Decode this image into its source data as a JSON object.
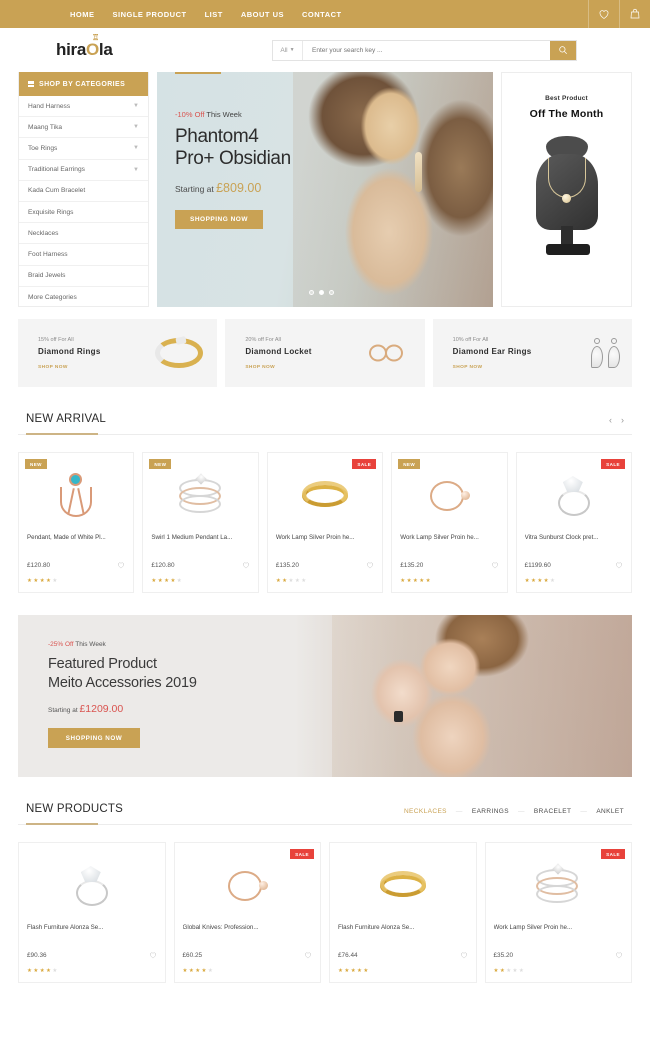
{
  "topbar": {
    "nav": [
      {
        "label": "HOME"
      },
      {
        "label": "SINGLE PRODUCT"
      },
      {
        "label": "LIST"
      },
      {
        "label": "ABOUT US"
      },
      {
        "label": "CONTACT"
      }
    ],
    "icons": [
      {
        "name": "wishlist-heart-icon"
      },
      {
        "name": "shopping-bag-icon"
      }
    ]
  },
  "header": {
    "logo_part1": "hira",
    "logo_o": "O",
    "logo_part2": "la",
    "search": {
      "category": "All",
      "placeholder": "Enter your search key ...",
      "value": ""
    }
  },
  "sidebar": {
    "title": "SHOP BY CATEGORIES",
    "items": [
      {
        "label": "Hand Harness",
        "expandable": true
      },
      {
        "label": "Maang Tika",
        "expandable": true
      },
      {
        "label": "Toe Rings",
        "expandable": true
      },
      {
        "label": "Traditional Earrings",
        "expandable": true
      },
      {
        "label": "Kada Cum Bracelet",
        "expandable": false
      },
      {
        "label": "Exquisite Rings",
        "expandable": false
      },
      {
        "label": "Necklaces",
        "expandable": false
      },
      {
        "label": "Foot Harness",
        "expandable": false
      },
      {
        "label": "Braid Jewels",
        "expandable": false
      },
      {
        "label": "More Categories",
        "expandable": false
      }
    ]
  },
  "hero": {
    "discount": "-10% Off",
    "kicker_rest": " This Week",
    "title_line1": "Phantom4",
    "title_line2": "Pro+ Obsidian",
    "starting_label": "Starting at ",
    "price": "£809.00",
    "button": "SHOPPING NOW"
  },
  "best_product": {
    "subtitle": "Best Product",
    "title": "Off The Month"
  },
  "promos": [
    {
      "off": "15% off For All",
      "name": "Diamond Rings",
      "shop": "SHOP NOW",
      "art": "ring-gold"
    },
    {
      "off": "20% off For All",
      "name": "Diamond Locket",
      "shop": "SHOP NOW",
      "art": "infinity"
    },
    {
      "off": "10% off For All",
      "name": "Diamond Ear Rings",
      "shop": "SHOP NOW",
      "art": "earrings"
    }
  ],
  "new_arrival": {
    "title": "NEW ARRIVAL",
    "prev": "‹",
    "next": "›",
    "products": [
      {
        "badge": "NEW",
        "badge_type": "new",
        "name": "Pendant, Made of White Pl...",
        "price": "£120.80",
        "rating": 4,
        "art": "pendant"
      },
      {
        "badge": "NEW",
        "badge_type": "new",
        "name": "Swirl 1 Medium Pendant La...",
        "price": "£120.80",
        "rating": 4,
        "art": "swirl"
      },
      {
        "badge": "SALE",
        "badge_type": "sale",
        "name": "Work Lamp Silver Proin he...",
        "price": "£135.20",
        "rating": 2,
        "art": "goldknot"
      },
      {
        "badge": "NEW",
        "badge_type": "new",
        "name": "Work Lamp Silver Proin he...",
        "price": "£135.20",
        "rating": 5,
        "art": "rose"
      },
      {
        "badge": "SALE",
        "badge_type": "sale",
        "name": "Vitra Sunburst Clock pret...",
        "price": "£1199.60",
        "rating": 4,
        "art": "solitaire"
      }
    ]
  },
  "featured": {
    "discount": "-25% Off",
    "kicker_rest": " This Week",
    "title_line1": "Featured Product",
    "title_line2": "Meito Accessories 2019",
    "starting_label": "Starting at ",
    "price": "£1209.00",
    "button": "SHOPPING NOW"
  },
  "new_products": {
    "title": "NEW PRODUCTS",
    "tabs": [
      {
        "label": "NECKLACES",
        "active": true
      },
      {
        "label": "EARRINGS",
        "active": false
      },
      {
        "label": "BRACELET",
        "active": false
      },
      {
        "label": "ANKLET",
        "active": false
      }
    ],
    "products": [
      {
        "badge": "",
        "badge_type": "",
        "name": "Flash Furniture Alonza Se...",
        "price": "£90.36",
        "rating": 4,
        "art": "solitaire"
      },
      {
        "badge": "SALE",
        "badge_type": "sale",
        "name": "Global Knives: Profession...",
        "price": "£60.25",
        "rating": 4,
        "art": "rose"
      },
      {
        "badge": "",
        "badge_type": "",
        "name": "Flash Furniture Alonza Se...",
        "price": "£76.44",
        "rating": 5,
        "art": "goldknot"
      },
      {
        "badge": "SALE",
        "badge_type": "sale",
        "name": "Work Lamp Silver Proin he...",
        "price": "£35.20",
        "rating": 2,
        "art": "swirl"
      }
    ]
  },
  "colors": {
    "brand_gold": "#c9a254",
    "sale_red": "#e8423b",
    "star_gold": "#d9a93f"
  }
}
